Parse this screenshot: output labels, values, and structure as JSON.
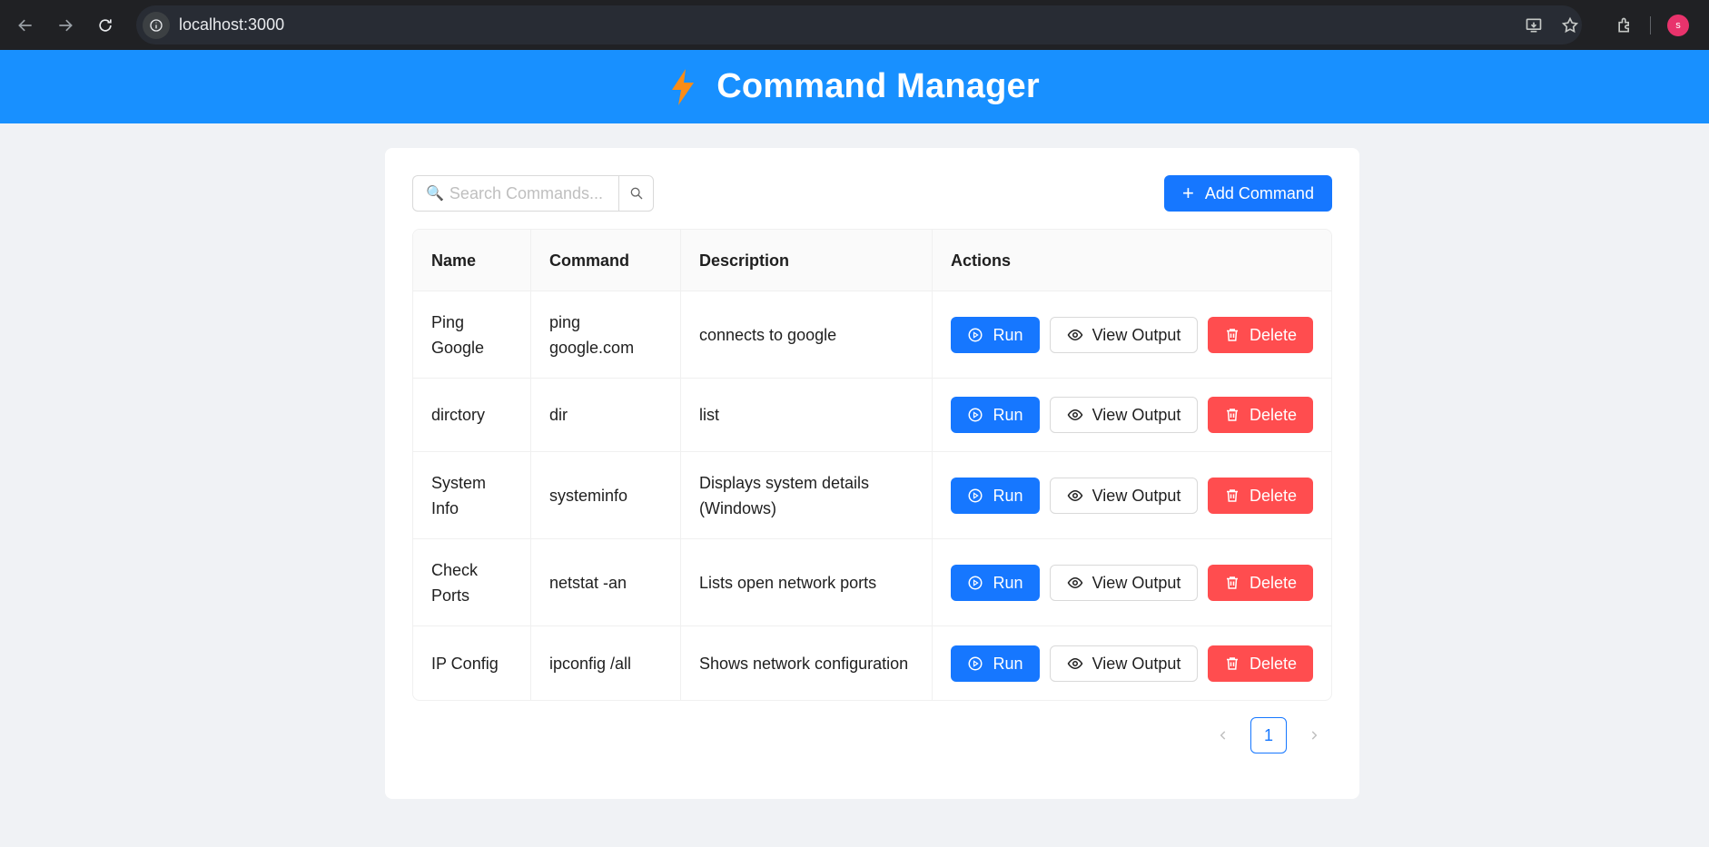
{
  "browser": {
    "url": "localhost:3000",
    "avatar_letter": "s"
  },
  "header": {
    "title": "Command Manager",
    "icon": "lightning-bolt-icon",
    "icon_color": "#fa8c16",
    "background": "#1890ff"
  },
  "toolbar": {
    "search_placeholder": "Search Commands...",
    "search_value": "",
    "add_label": "Add Command"
  },
  "table": {
    "columns": [
      "Name",
      "Command",
      "Description",
      "Actions"
    ],
    "rows": [
      {
        "name": "Ping Google",
        "command": "ping google.com",
        "description": "connects to google"
      },
      {
        "name": "dirctory",
        "command": "dir",
        "description": "list"
      },
      {
        "name": "System Info",
        "command": "systeminfo",
        "description": "Displays system details (Windows)"
      },
      {
        "name": "Check Ports",
        "command": "netstat -an",
        "description": "Lists open network ports"
      },
      {
        "name": "IP Config",
        "command": "ipconfig /all",
        "description": "Shows network configuration"
      }
    ],
    "actions": {
      "run": "Run",
      "view": "View Output",
      "delete": "Delete"
    }
  },
  "colors": {
    "primary": "#1677ff",
    "danger": "#ff4d4f"
  },
  "pagination": {
    "current_page": "1"
  }
}
